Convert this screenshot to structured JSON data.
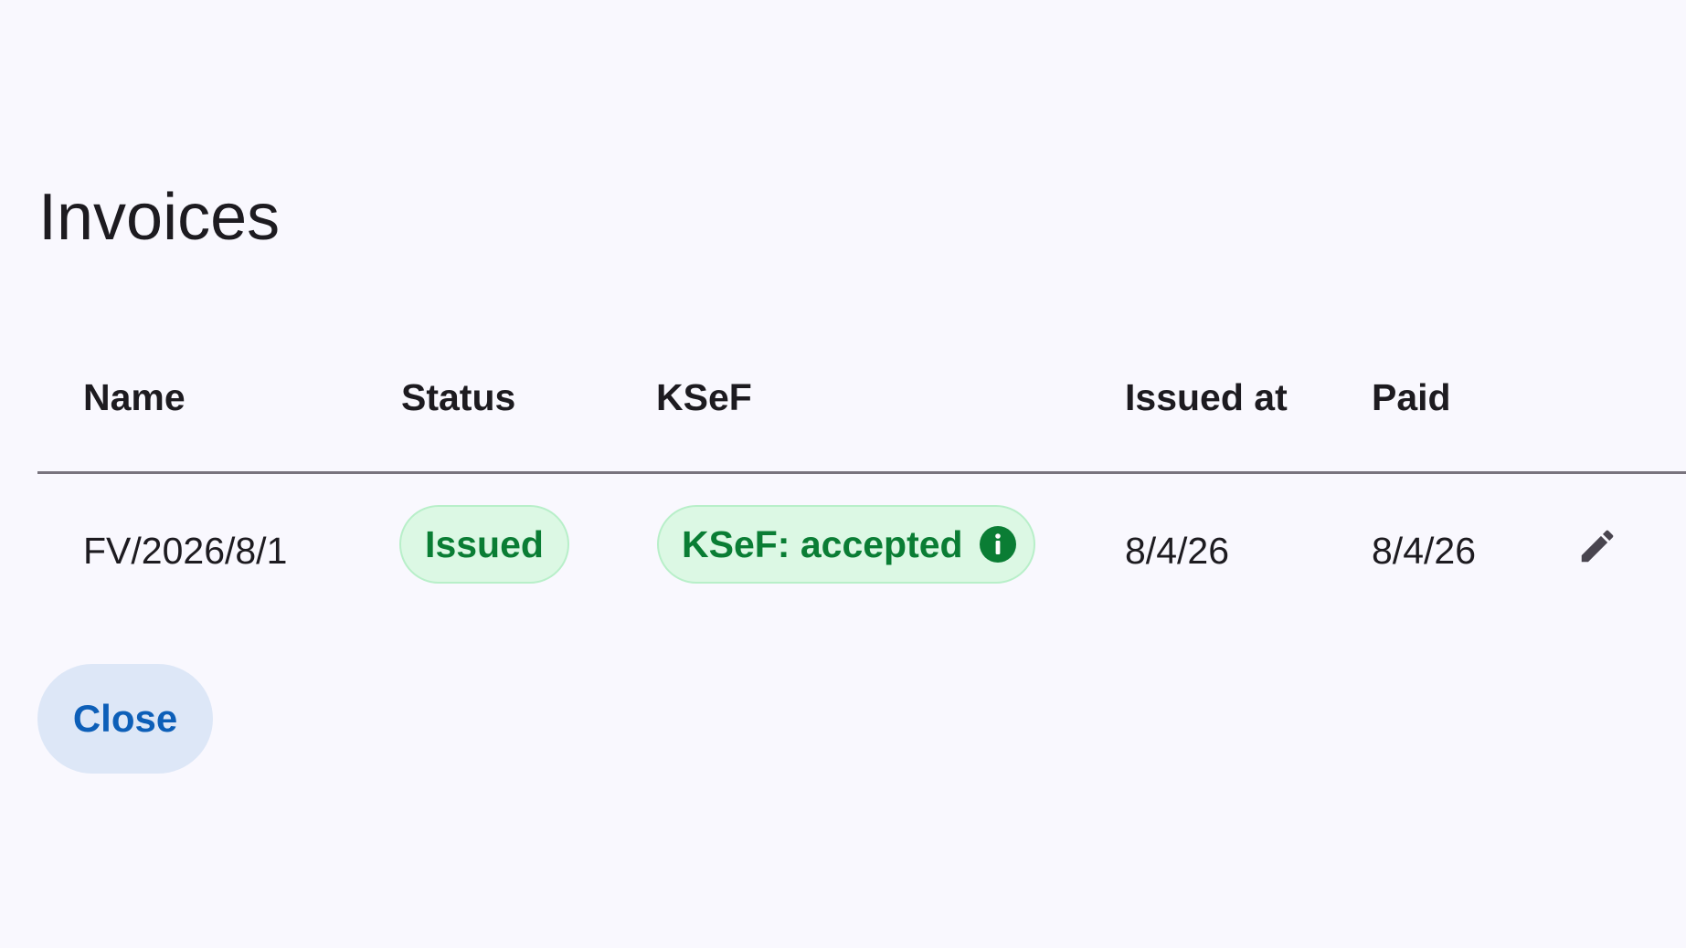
{
  "dialog": {
    "title": "Invoices",
    "close_label": "Close"
  },
  "table": {
    "headers": {
      "name": "Name",
      "status": "Status",
      "ksef": "KSeF",
      "issued_at": "Issued at",
      "paid": "Paid"
    },
    "rows": [
      {
        "name": "FV/2026/8/1",
        "status": "Issued",
        "ksef": "KSeF: accepted",
        "issued_at": "8/4/26",
        "paid": "8/4/26"
      }
    ]
  },
  "icons": {
    "ksef_info": "info-icon",
    "row_action": "edit-icon"
  },
  "colors": {
    "background": "#f9f8fe",
    "chip_background": "#dcf8e4",
    "chip_border": "#b8efc9",
    "chip_text": "#0a7d34",
    "button_background": "#dde7f7",
    "button_text": "#0d5fb8",
    "divider": "#79747e"
  }
}
